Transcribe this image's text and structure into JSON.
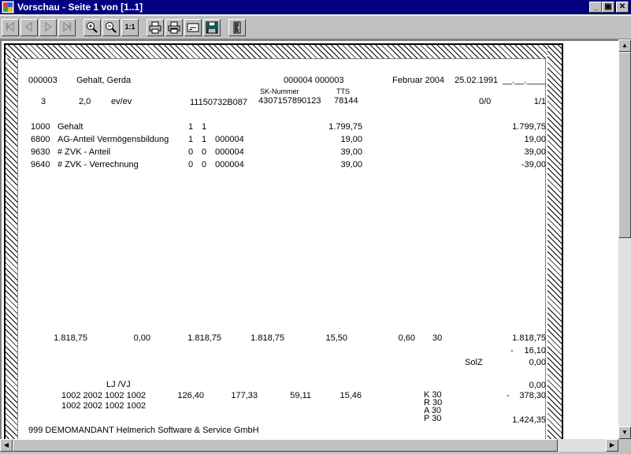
{
  "window": {
    "title": "Vorschau - Seite 1 von [1..1]",
    "minimize_label": "_",
    "maximize_label": "▣",
    "close_label": "✕"
  },
  "toolbar": {
    "zoom_full_label": "1:1"
  },
  "report": {
    "header": {
      "employee_no": "000003",
      "employee_name": "Gehalt, Gerda",
      "numbers": "000004 000003",
      "period": "Februar 2004",
      "birth_date": "25.02.1991",
      "date_blank": "__.__.____",
      "sk_label": "SK-Nummer",
      "tts_label": "TTS",
      "tax_class": "3",
      "child_allowance": "2,0",
      "religion": "ev/ev",
      "insurance_no": "11150732B087",
      "sk_number": "4307157890123",
      "tts": "78144",
      "ratio_a": "0/0",
      "ratio_b": "1/1"
    },
    "lines": [
      {
        "code": "1000",
        "desc": "Gehalt",
        "f1": "1",
        "f2": "1",
        "ref": "",
        "amount": "1.799,75",
        "total": "1.799,75"
      },
      {
        "code": "6800",
        "desc": "AG-Anteil Vermögensbildung",
        "f1": "1",
        "f2": "1",
        "ref": "000004",
        "amount": "19,00",
        "total": "19,00"
      },
      {
        "code": "9630",
        "desc": "# ZVK - Anteil",
        "f1": "0",
        "f2": "0",
        "ref": "000004",
        "amount": "39,00",
        "total": "39,00"
      },
      {
        "code": "9640",
        "desc": "# ZVK - Verrechnung",
        "f1": "0",
        "f2": "0",
        "ref": "000004",
        "amount": "39,00",
        "total": "-39,00"
      }
    ],
    "totals": {
      "v1": "1.818,75",
      "v2": "0,00",
      "v3": "1.818,75",
      "v4": "1.818,75",
      "v5": "15,50",
      "v6": "0,60",
      "v7": "30",
      "v8": "1.818,75",
      "deduction_sign": "-",
      "deduction": "16,10",
      "solz_label": "SolZ",
      "solz": "0,00",
      "ljvj_label": "LJ /VJ",
      "ljvj_value": "0,00",
      "row1_codes": "1002 2002 1002 1002",
      "row2_codes": "1002 2002 1002 1002",
      "a1": "126,40",
      "a2": "177,33",
      "a3": "59,11",
      "a4": "15,46",
      "k_label": "K 30",
      "r_label": "R 30",
      "a_label": "A 30",
      "p_label": "P 30",
      "minus_sign": "-",
      "minus_value": "378,30",
      "net": "1.424,35"
    },
    "footer": "999  DEMOMANDANT Helmerich Software & Service GmbH"
  }
}
